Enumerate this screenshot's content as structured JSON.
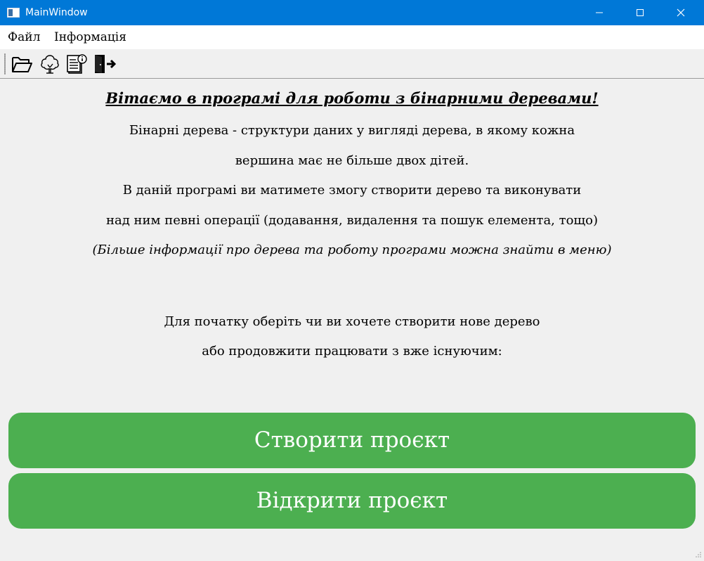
{
  "window": {
    "title": "MainWindow",
    "controls": [
      "minimize-icon",
      "maximize-icon",
      "close-icon"
    ]
  },
  "menu": {
    "items": [
      {
        "label": "Файл"
      },
      {
        "label": "Інформація"
      }
    ]
  },
  "toolbar": {
    "icons": [
      "open-folder-icon",
      "tree-icon",
      "info-document-icon",
      "exit-icon"
    ]
  },
  "content": {
    "welcome": "Вітаємо в програмі для роботи з бінарними деревами!",
    "lines": [
      "Бінарні дерева - структури даних у вигляді дерева, в якому кожна",
      "вершина має не більше двох дітей.",
      "В даній програмі ви матимете змогу створити дерево та виконувати",
      "над ним певні операції (додавання, видалення та пошук елемента, тощо)",
      "(Більше інформації про дерева та роботу програми можна знайти в меню)",
      "Для початку оберіть чи ви хочете створити нове дерево",
      "або продовжити працювати з вже існуючим:"
    ]
  },
  "buttons": {
    "create_label": "Створити проєкт",
    "open_label": "Відкрити проєкт"
  },
  "colors": {
    "titlebar": "#0078d7",
    "button": "#4caf50",
    "background": "#f0f0f0"
  }
}
